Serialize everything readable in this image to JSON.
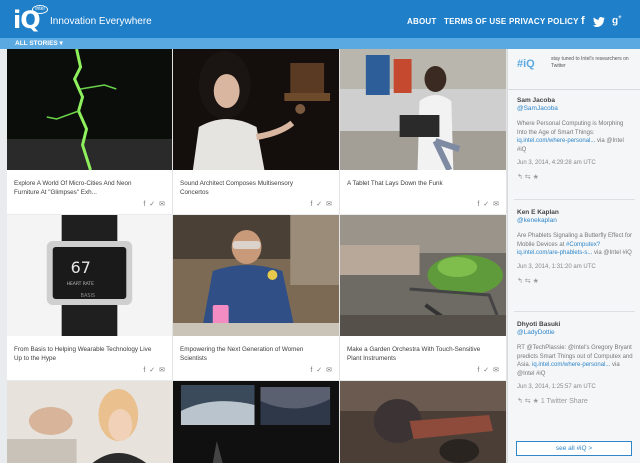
{
  "header": {
    "logo_text": "iQ",
    "logo_badge": "intel",
    "title": "Innovation Everywhere",
    "nav": [
      "ABOUT",
      "TERMS OF USE",
      "PRIVACY POLICY"
    ],
    "social_icons": [
      "facebook-icon",
      "twitter-icon",
      "google-plus-icon"
    ]
  },
  "subbar": {
    "label": "ALL STORIES ▾"
  },
  "stories": [
    {
      "caption": "Explore A World Of Micro-Cities And Neon Furniture At \"Glimpses\" Exh..."
    },
    {
      "caption": "Sound Architect Composes Multisensory Concertos"
    },
    {
      "caption": "A Tablet That Lays Down the Funk"
    },
    {
      "caption": "From Basis to Helping Wearable Technology Live Up to the Hype"
    },
    {
      "caption": "Empowering the Next Generation of Women Scientists"
    },
    {
      "caption": "Make a Garden Orchestra With Touch-Sensitive Plant Instruments"
    }
  ],
  "share": "f ✓ ✉",
  "watch": {
    "value": "67",
    "label": "HEART RATE",
    "brand": "BASIS"
  },
  "sidebar": {
    "tag": "#iQ",
    "stay_text": "stay tuned to Intel's researchers on Twitter",
    "tweets": [
      {
        "name": "Sam Jacoba",
        "handle": "@SamJacoba",
        "text_a": "Where Personal Computing is Morphing Into the Age of Smart Things: ",
        "link": "iq.intel.com/where-personal...",
        "text_b": " via @Intel #iQ",
        "time": "Jun 3, 2014, 4:29:28 am UTC",
        "actions": "↰  ⇆  ★"
      },
      {
        "name": "Ken E Kaplan",
        "handle": "@kenekaplan",
        "text_a": "Are Phablets Signaling a Butterfly Effect for Mobile Devices at ",
        "link": "#Computex? iq.intel.com/are-phablets-s...",
        "text_b": " via @Intel #iQ",
        "time": "Jun 3, 2014, 1:31:20 am UTC",
        "actions": "↰  ⇆  ★"
      },
      {
        "name": "Dhyoti Basuki",
        "handle": "@LadyDottie",
        "text_a": "RT @TechPlassie: @Intel's Gregory Bryant predicts Smart Things out of Computex and Asia. ",
        "link": "iq.intel.com/where-personal...",
        "text_b": " via @Intel #iQ",
        "time": "Jun 3, 2014, 1:25:57 am UTC",
        "actions": "↰  ⇆  ★  1 Twitter Share"
      }
    ],
    "see_all": "see all #iQ >"
  },
  "colors": {
    "header": "#1f7fc9",
    "subbar": "#5ba9e1",
    "link": "#2f86c9"
  }
}
